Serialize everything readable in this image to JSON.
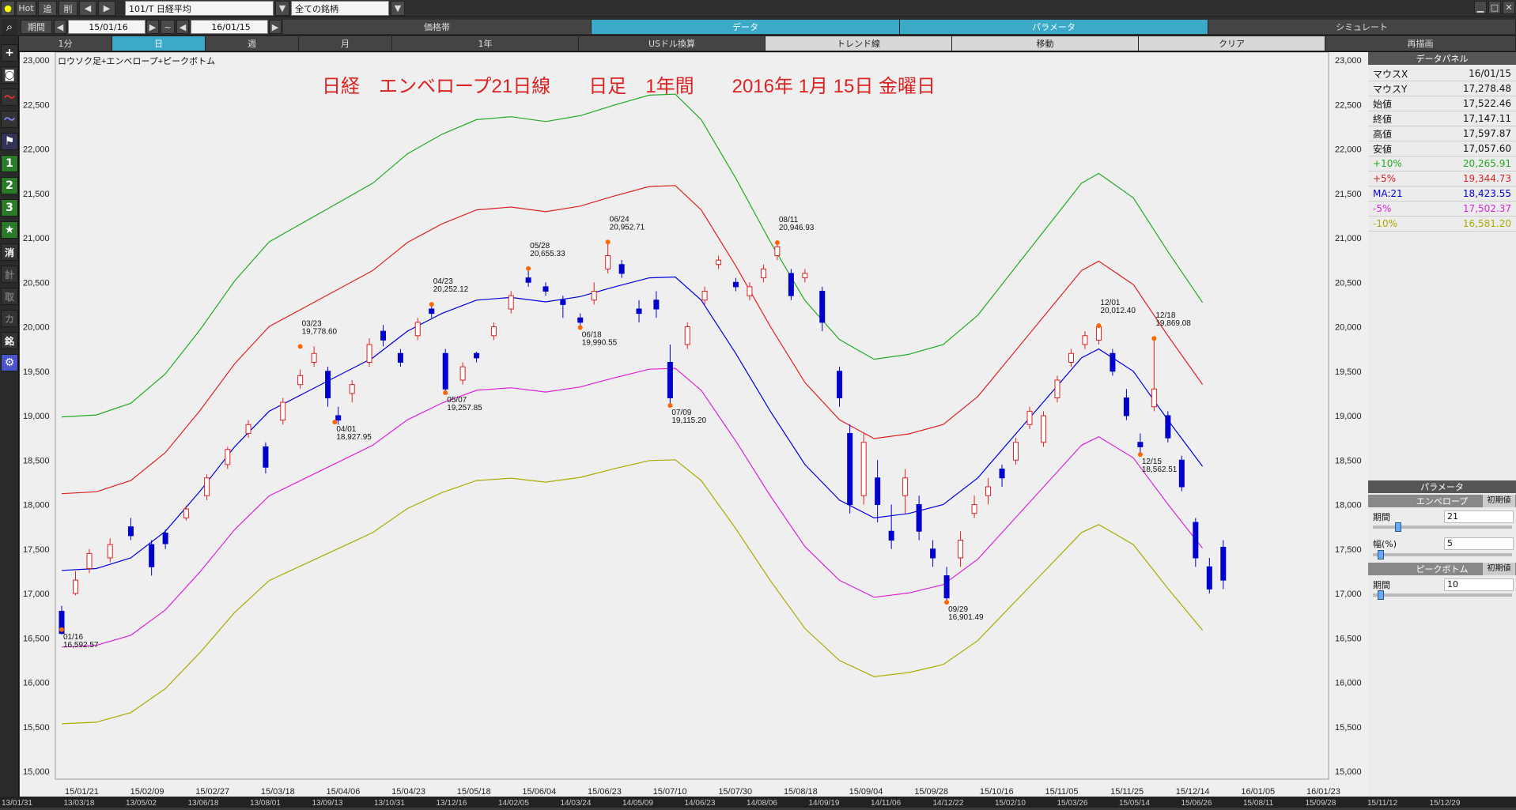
{
  "toolbar": {
    "hot": "Hot",
    "tsui": "追",
    "sakujo": "削",
    "symbol": "101/T 日経平均",
    "filter": "全ての銘柄"
  },
  "period": {
    "label": "期間",
    "from": "15/01/16",
    "tilde": "~",
    "to": "16/01/15"
  },
  "tabs_top": [
    "価格帯",
    "データ",
    "パラメータ",
    "シミュレート"
  ],
  "tabs_second": [
    "1分",
    "日",
    "週",
    "月",
    "1年",
    "USドル換算",
    "トレンド線",
    "移動",
    "クリア",
    "再描画"
  ],
  "sidebar": [
    "消",
    "計",
    "取",
    "カ",
    "銘"
  ],
  "chart_data": {
    "type": "candlestick",
    "label": "ロウソク足+エンベロープ+ピークボトム",
    "title": "日経　エンベロープ21日線　　日足　1年間　　2016年 1月 15日 金曜日",
    "ylim": [
      15000,
      23000
    ],
    "yticks": [
      "23,000",
      "22,500",
      "22,000",
      "21,500",
      "21,000",
      "20,500",
      "20,000",
      "19,500",
      "19,000",
      "18,500",
      "18,000",
      "17,500",
      "17,000",
      "16,500",
      "16,000",
      "15,500",
      "15,000"
    ],
    "xticks": [
      "15/01/21",
      "15/02/09",
      "15/02/27",
      "15/03/18",
      "15/04/06",
      "15/04/23",
      "15/05/18",
      "15/06/04",
      "15/06/23",
      "15/07/10",
      "15/07/30",
      "15/08/18",
      "15/09/04",
      "15/09/28",
      "15/10/16",
      "15/11/05",
      "15/11/25",
      "15/12/14",
      "16/01/05",
      "16/01/23"
    ],
    "long_ticks": [
      "13/01/31",
      "13/03/18",
      "13/05/02",
      "13/06/18",
      "13/08/01",
      "13/09/13",
      "13/10/31",
      "13/12/16",
      "14/02/05",
      "14/03/24",
      "14/05/09",
      "14/06/23",
      "14/08/06",
      "14/09/19",
      "14/11/06",
      "14/12/22",
      "15/02/10",
      "15/03/26",
      "15/05/14",
      "15/06/26",
      "15/08/11",
      "15/09/28",
      "15/11/12",
      "15/12/29"
    ],
    "ma": [
      [
        0,
        17260
      ],
      [
        20,
        17280
      ],
      [
        40,
        17400
      ],
      [
        60,
        17700
      ],
      [
        80,
        18150
      ],
      [
        100,
        18650
      ],
      [
        120,
        19050
      ],
      [
        140,
        19250
      ],
      [
        160,
        19450
      ],
      [
        180,
        19650
      ],
      [
        200,
        19950
      ],
      [
        220,
        20150
      ],
      [
        240,
        20300
      ],
      [
        260,
        20330
      ],
      [
        280,
        20280
      ],
      [
        300,
        20340
      ],
      [
        320,
        20450
      ],
      [
        340,
        20550
      ],
      [
        355,
        20560
      ],
      [
        370,
        20300
      ],
      [
        390,
        19700
      ],
      [
        410,
        19050
      ],
      [
        430,
        18450
      ],
      [
        450,
        18050
      ],
      [
        470,
        17850
      ],
      [
        490,
        17900
      ],
      [
        510,
        18000
      ],
      [
        530,
        18300
      ],
      [
        550,
        18750
      ],
      [
        570,
        19200
      ],
      [
        590,
        19650
      ],
      [
        600,
        19750
      ],
      [
        620,
        19500
      ],
      [
        640,
        18950
      ],
      [
        660,
        18430
      ]
    ],
    "ma_color": "#0000dd",
    "envelopes": [
      {
        "name": "+10%",
        "pct": 10,
        "color": "#22aa22"
      },
      {
        "name": "+5%",
        "pct": 5,
        "color": "#dd2222"
      },
      {
        "name": "-5%",
        "pct": -5,
        "color": "#dd22dd"
      },
      {
        "name": "-10%",
        "pct": -10,
        "color": "#aaaa00"
      }
    ],
    "candles": [
      [
        0,
        16800,
        16550,
        16860,
        16540
      ],
      [
        8,
        17000,
        17150,
        17250,
        16980
      ],
      [
        16,
        17280,
        17450,
        17500,
        17230
      ],
      [
        28,
        17400,
        17550,
        17620,
        17350
      ],
      [
        40,
        17750,
        17650,
        17850,
        17600
      ],
      [
        52,
        17550,
        17300,
        17600,
        17200
      ],
      [
        60,
        17680,
        17560,
        17720,
        17500
      ],
      [
        72,
        17850,
        17950,
        17990,
        17820
      ],
      [
        84,
        18100,
        18300,
        18340,
        18050
      ],
      [
        96,
        18450,
        18620,
        18650,
        18400
      ],
      [
        108,
        18800,
        18900,
        18950,
        18750
      ],
      [
        118,
        18650,
        18420,
        18700,
        18350
      ],
      [
        128,
        18950,
        19150,
        19200,
        18900
      ],
      [
        138,
        19350,
        19450,
        19520,
        19300
      ],
      [
        146,
        19600,
        19700,
        19780,
        19550
      ],
      [
        154,
        19500,
        19200,
        19550,
        19100
      ],
      [
        160,
        19000,
        18950,
        19100,
        18900
      ],
      [
        168,
        19250,
        19350,
        19400,
        19150
      ],
      [
        178,
        19600,
        19800,
        19870,
        19550
      ],
      [
        186,
        19950,
        19850,
        20020,
        19780
      ],
      [
        196,
        19700,
        19600,
        19750,
        19550
      ],
      [
        206,
        19900,
        20050,
        20100,
        19850
      ],
      [
        214,
        20200,
        20150,
        20252,
        20100
      ],
      [
        222,
        19700,
        19300,
        19750,
        19258
      ],
      [
        232,
        19400,
        19550,
        19600,
        19350
      ],
      [
        240,
        19700,
        19650,
        19720,
        19600
      ],
      [
        250,
        19900,
        20000,
        20050,
        19850
      ],
      [
        260,
        20200,
        20350,
        20400,
        20150
      ],
      [
        270,
        20550,
        20500,
        20655,
        20450
      ],
      [
        280,
        20450,
        20400,
        20500,
        20350
      ],
      [
        290,
        20300,
        20250,
        20350,
        20100
      ],
      [
        300,
        20100,
        20050,
        20150,
        19990
      ],
      [
        308,
        20300,
        20400,
        20500,
        20250
      ],
      [
        316,
        20650,
        20800,
        20952,
        20600
      ],
      [
        324,
        20700,
        20600,
        20750,
        20550
      ],
      [
        334,
        20200,
        20150,
        20300,
        20050
      ],
      [
        344,
        20300,
        20200,
        20400,
        20100
      ],
      [
        352,
        19600,
        19200,
        19800,
        19115
      ],
      [
        362,
        19800,
        20000,
        20050,
        19750
      ],
      [
        372,
        20300,
        20400,
        20450,
        20250
      ],
      [
        380,
        20700,
        20750,
        20800,
        20650
      ],
      [
        390,
        20500,
        20450,
        20550,
        20400
      ],
      [
        398,
        20350,
        20450,
        20500,
        20300
      ],
      [
        406,
        20550,
        20650,
        20700,
        20500
      ],
      [
        414,
        20800,
        20900,
        20946,
        20750
      ],
      [
        422,
        20600,
        20350,
        20650,
        20300
      ],
      [
        430,
        20550,
        20600,
        20650,
        20500
      ],
      [
        440,
        20400,
        20050,
        20450,
        19950
      ],
      [
        450,
        19500,
        19200,
        19550,
        19100
      ],
      [
        456,
        18800,
        18000,
        18900,
        17900
      ],
      [
        464,
        18100,
        18700,
        18800,
        18000
      ],
      [
        472,
        18300,
        18000,
        18500,
        17800
      ],
      [
        480,
        17700,
        17600,
        18000,
        17500
      ],
      [
        488,
        18100,
        18300,
        18400,
        17900
      ],
      [
        496,
        18000,
        17700,
        18100,
        17600
      ],
      [
        504,
        17500,
        17400,
        17600,
        17300
      ],
      [
        512,
        17200,
        16950,
        17300,
        16901
      ],
      [
        520,
        17400,
        17600,
        17700,
        17300
      ],
      [
        528,
        17900,
        18000,
        18100,
        17850
      ],
      [
        536,
        18100,
        18200,
        18300,
        18000
      ],
      [
        544,
        18400,
        18300,
        18450,
        18200
      ],
      [
        552,
        18500,
        18700,
        18750,
        18450
      ],
      [
        560,
        18900,
        19050,
        19100,
        18850
      ],
      [
        568,
        18700,
        19000,
        19050,
        18650
      ],
      [
        576,
        19200,
        19400,
        19450,
        19150
      ],
      [
        584,
        19600,
        19700,
        19750,
        19550
      ],
      [
        592,
        19800,
        19900,
        19950,
        19750
      ],
      [
        600,
        19850,
        20000,
        20012,
        19800
      ],
      [
        608,
        19700,
        19500,
        19750,
        19450
      ],
      [
        616,
        19200,
        19000,
        19300,
        18950
      ],
      [
        624,
        18700,
        18650,
        18800,
        18563
      ],
      [
        632,
        19100,
        19300,
        19869,
        19050
      ],
      [
        640,
        19000,
        18750,
        19050,
        18700
      ],
      [
        648,
        18500,
        18200,
        18550,
        18150
      ],
      [
        656,
        17800,
        17400,
        17850,
        17300
      ],
      [
        664,
        17300,
        17050,
        17400,
        17000
      ],
      [
        672,
        17520,
        17150,
        17600,
        17050
      ]
    ],
    "peaks": [
      {
        "x": 0,
        "y": 16593,
        "date": "01/16",
        "val": "16,592.57",
        "pos": "below"
      },
      {
        "x": 138,
        "y": 19779,
        "date": "03/23",
        "val": "19,778.60",
        "pos": "above"
      },
      {
        "x": 158,
        "y": 18928,
        "date": "04/01",
        "val": "18,927.95",
        "pos": "below"
      },
      {
        "x": 214,
        "y": 20252,
        "date": "04/23",
        "val": "20,252.12",
        "pos": "above"
      },
      {
        "x": 222,
        "y": 19258,
        "date": "05/07",
        "val": "19,257.85",
        "pos": "below"
      },
      {
        "x": 270,
        "y": 20655,
        "date": "05/28",
        "val": "20,655.33",
        "pos": "above"
      },
      {
        "x": 300,
        "y": 19991,
        "date": "06/18",
        "val": "19,990.55",
        "pos": "below"
      },
      {
        "x": 316,
        "y": 20953,
        "date": "06/24",
        "val": "20,952.71",
        "pos": "above"
      },
      {
        "x": 352,
        "y": 19115,
        "date": "07/09",
        "val": "19,115.20",
        "pos": "below"
      },
      {
        "x": 414,
        "y": 20947,
        "date": "08/11",
        "val": "20,946.93",
        "pos": "above"
      },
      {
        "x": 512,
        "y": 16901,
        "date": "09/29",
        "val": "16,901.49",
        "pos": "below"
      },
      {
        "x": 600,
        "y": 20012,
        "date": "12/01",
        "val": "20,012.40",
        "pos": "above"
      },
      {
        "x": 624,
        "y": 18563,
        "date": "12/15",
        "val": "18,562.51",
        "pos": "below"
      },
      {
        "x": 632,
        "y": 19869,
        "date": "12/18",
        "val": "19,869.08",
        "pos": "above"
      }
    ]
  },
  "data_panel": {
    "title": "データパネル",
    "rows": [
      {
        "k": "マウスX",
        "v": "16/01/15",
        "c": "#111111"
      },
      {
        "k": "マウスY",
        "v": "17,278.48",
        "c": "#111111"
      },
      {
        "k": "始値",
        "v": "17,522.46",
        "c": "#111111"
      },
      {
        "k": "終値",
        "v": "17,147.11",
        "c": "#111111"
      },
      {
        "k": "高値",
        "v": "17,597.87",
        "c": "#111111"
      },
      {
        "k": "安値",
        "v": "17,057.60",
        "c": "#111111"
      },
      {
        "k": "+10%",
        "v": "20,265.91",
        "c": "#22aa22"
      },
      {
        "k": "+5%",
        "v": "19,344.73",
        "c": "#dd2222"
      },
      {
        "k": "MA:21",
        "v": "18,423.55",
        "c": "#0000dd"
      },
      {
        "k": "-5%",
        "v": "17,502.37",
        "c": "#dd22dd"
      },
      {
        "k": "-10%",
        "v": "16,581.20",
        "c": "#aaaa00"
      }
    ]
  },
  "param_panel": {
    "title": "パラメータ",
    "envelope": "エンベロープ",
    "reset": "初期値",
    "period_label": "期間",
    "period": "21",
    "width_label": "幅(%)",
    "width": "5",
    "peak": "ピークボトム",
    "peak_period": "10"
  }
}
